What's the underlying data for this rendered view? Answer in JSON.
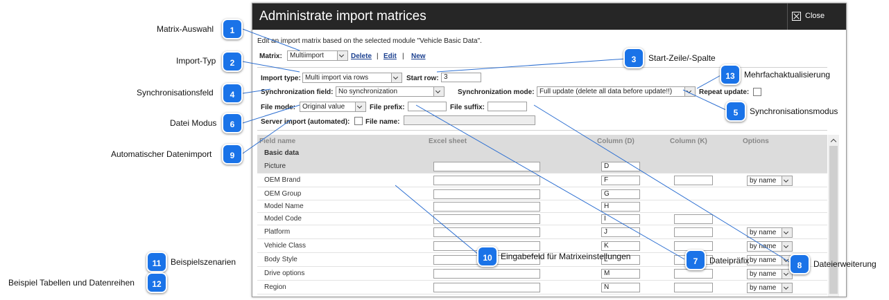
{
  "dialog": {
    "title": "Administrate import matrices",
    "close_label": "Close",
    "description": "Edit an import matrix based on the selected module \"Vehicle Basic Data\".",
    "matrix_label": "Matrix:",
    "matrix_value": "Multiimport",
    "delete_label": "Delete",
    "edit_label": "Edit",
    "new_label": "New",
    "sep": "|",
    "import_type_label": "Import type:",
    "import_type_value": "Multi import via rows",
    "start_row_label": "Start row:",
    "start_row_value": "3",
    "sync_field_label": "Synchronization field:",
    "sync_field_value": "No synchronization",
    "sync_mode_label": "Synchronization mode:",
    "sync_mode_value": "Full update (delete all data before update!!)",
    "repeat_update_label": "Repeat update:",
    "file_mode_label": "File mode:",
    "file_mode_value": "Original value",
    "file_prefix_label": "File prefix:",
    "file_suffix_label": "File suffix:",
    "server_import_label": "Server import (automated):",
    "file_name_label": "File name:"
  },
  "table": {
    "headers": [
      "Field name",
      "Excel sheet",
      "Column (D)",
      "Column (K)",
      "Options"
    ],
    "group": "Basic data",
    "rows": [
      {
        "name": "Picture",
        "col_d": "D",
        "has_k": false,
        "option": ""
      },
      {
        "name": "OEM Brand",
        "col_d": "F",
        "has_k": true,
        "option": "by name"
      },
      {
        "name": "OEM Group",
        "col_d": "G",
        "has_k": false,
        "option": ""
      },
      {
        "name": "Model Name",
        "col_d": "H",
        "has_k": false,
        "option": ""
      },
      {
        "name": "Model Code",
        "col_d": "I",
        "has_k": true,
        "option": ""
      },
      {
        "name": "Platform",
        "col_d": "J",
        "has_k": true,
        "option": "by name"
      },
      {
        "name": "Vehicle Class",
        "col_d": "K",
        "has_k": true,
        "option": "by name"
      },
      {
        "name": "Body Style",
        "col_d": "L",
        "has_k": true,
        "option": "by name"
      },
      {
        "name": "Drive options",
        "col_d": "M",
        "has_k": true,
        "option": "by name"
      },
      {
        "name": "Region",
        "col_d": "N",
        "has_k": true,
        "option": "by name"
      }
    ]
  },
  "callouts": [
    {
      "num": "1",
      "label": "Matrix-Auswahl"
    },
    {
      "num": "2",
      "label": "Import-Typ"
    },
    {
      "num": "3",
      "label": "Start-Zeile/-Spalte"
    },
    {
      "num": "4",
      "label": "Synchronisationsfeld"
    },
    {
      "num": "5",
      "label": "Synchronisationsmodus"
    },
    {
      "num": "6",
      "label": "Datei Modus"
    },
    {
      "num": "7",
      "label": "Dateipräfix"
    },
    {
      "num": "8",
      "label": "Dateierweiterung"
    },
    {
      "num": "9",
      "label": "Automatischer Datenimport"
    },
    {
      "num": "10",
      "label": "Eingabefeld für Matrixeinstellungen"
    },
    {
      "num": "11",
      "label": "Beispielszenarien"
    },
    {
      "num": "12",
      "label": "Beispiel Tabellen und Datenreihen"
    },
    {
      "num": "13",
      "label": "Mehrfachaktualisierung"
    }
  ],
  "colors": {
    "callout": "#1a73e8",
    "titlebar": "#262626",
    "link": "#1a3f8f"
  }
}
